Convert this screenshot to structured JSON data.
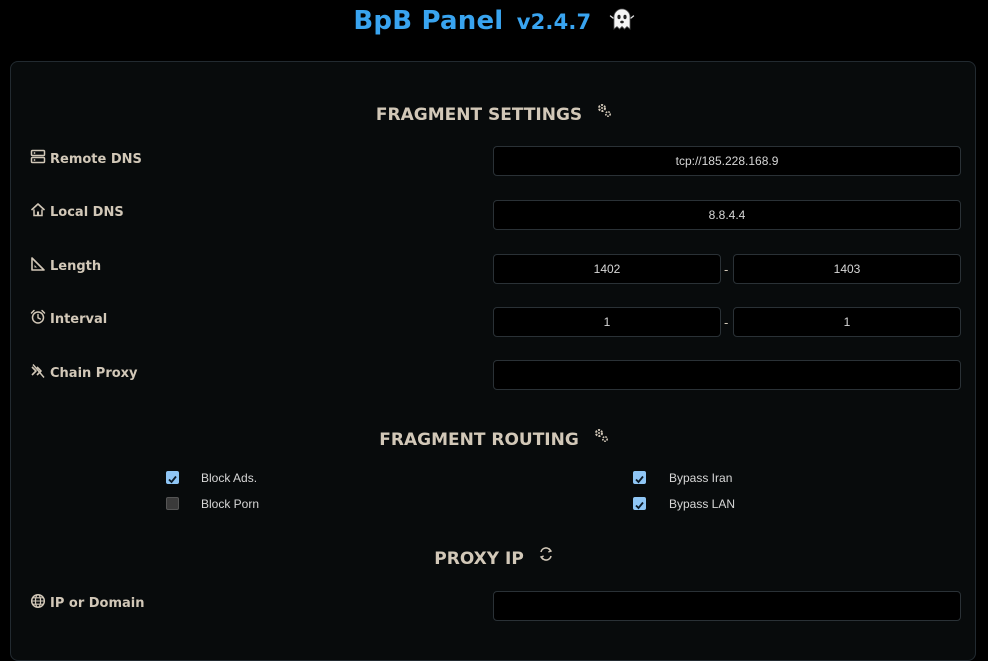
{
  "header": {
    "title": "BpB Panel",
    "version": "v2.4.7"
  },
  "fragment_settings": {
    "title": "FRAGMENT SETTINGS",
    "remote_dns": {
      "label": "Remote DNS",
      "value": "tcp://185.228.168.9"
    },
    "local_dns": {
      "label": "Local DNS",
      "value": "8.8.4.4"
    },
    "length": {
      "label": "Length",
      "min": "1402",
      "sep": "-",
      "max": "1403"
    },
    "interval": {
      "label": "Interval",
      "min": "1",
      "sep": "-",
      "max": "1"
    },
    "chain_proxy": {
      "label": "Chain Proxy",
      "value": ""
    }
  },
  "fragment_routing": {
    "title": "FRAGMENT ROUTING",
    "options": [
      {
        "label": "Block Ads.",
        "checked": true
      },
      {
        "label": "Block Porn",
        "checked": false
      },
      {
        "label": "Bypass Iran",
        "checked": true
      },
      {
        "label": "Bypass LAN",
        "checked": true
      }
    ]
  },
  "proxy_ip": {
    "title": "PROXY IP",
    "ip_or_domain": {
      "label": "IP or Domain",
      "value": ""
    }
  },
  "colors": {
    "accent": "#39a4f0",
    "label": "#d2c8b8",
    "checkbox": "#8fc6f5",
    "background": "#000000"
  }
}
